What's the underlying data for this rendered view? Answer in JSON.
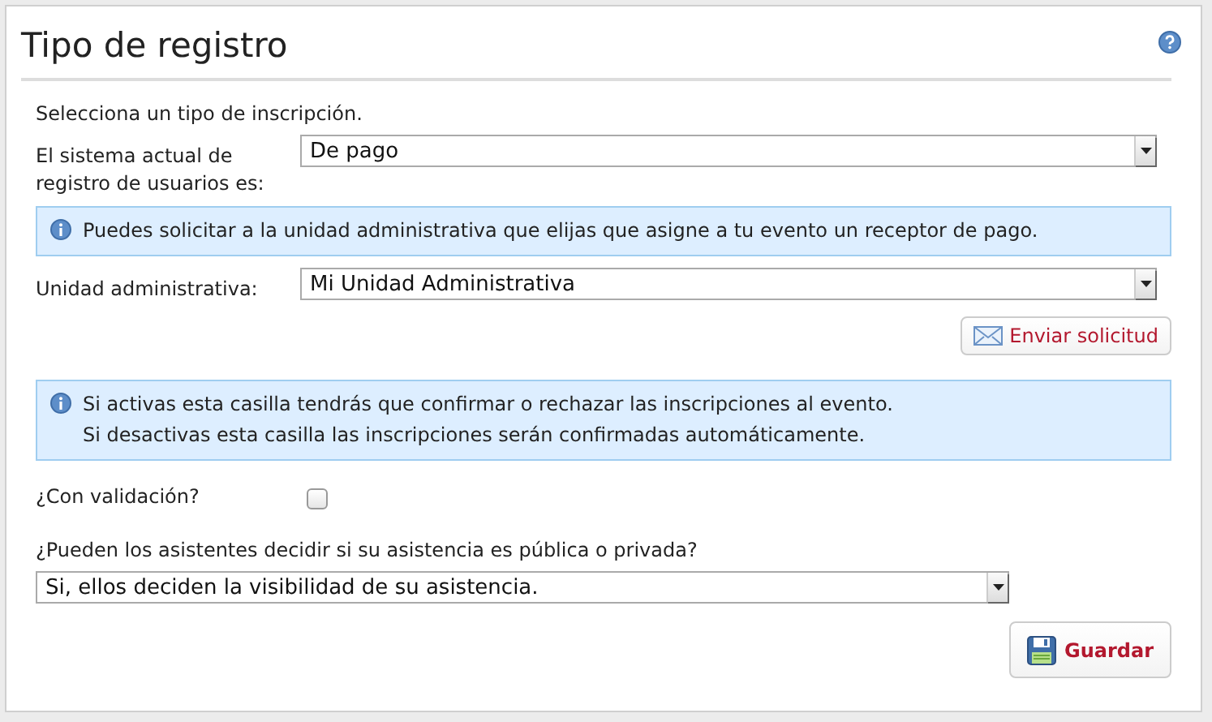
{
  "panel": {
    "title": "Tipo de registro"
  },
  "intro": "Selecciona un tipo de inscripción.",
  "fields": [
    {
      "kind": "select",
      "label": "El sistema actual de registro de usuarios es:",
      "value": "De pago"
    },
    {
      "kind": "info",
      "lines": [
        "Puedes solicitar a la unidad administrativa que elijas que asigne a tu evento un receptor de pago."
      ]
    },
    {
      "kind": "select",
      "label": "Unidad administrativa:",
      "value": "Mi Unidad Administrativa"
    },
    {
      "kind": "send",
      "label": "Enviar solicitud"
    },
    {
      "kind": "info",
      "lines": [
        "Si activas esta casilla tendrás que confirmar o rechazar las inscripciones al evento.",
        "Si desactivas esta casilla las inscripciones serán confirmadas automáticamente."
      ]
    },
    {
      "kind": "checkbox",
      "label": "¿Con validación?",
      "checked": false
    },
    {
      "kind": "question",
      "label": "¿Pueden los asistentes decidir si su asistencia es pública o privada?"
    },
    {
      "kind": "wide-select",
      "value": "Si, ellos deciden la visibilidad de su asistencia."
    },
    {
      "kind": "save",
      "label": "Guardar"
    }
  ]
}
